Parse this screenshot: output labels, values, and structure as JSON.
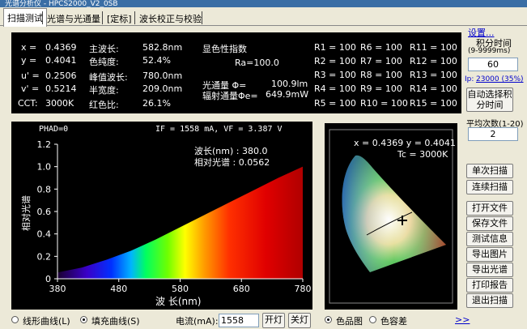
{
  "window": {
    "title": "光谱分析仪 - HPCS2000_V2_0SB"
  },
  "tabs": [
    "扫描测试",
    "光谱与光通量",
    "[定标]",
    "波长校正与校验"
  ],
  "summary": {
    "x": "x =",
    "x_val": "0.4369",
    "y": "y =",
    "y_val": "0.4041",
    "u": "u' =",
    "u_val": "0.2506",
    "v": "v' =",
    "v_val": "0.5214",
    "cct": "CCT:",
    "cct_val": "3000K",
    "dominant": "主波长:",
    "dominant_val": "582.8nm",
    "purity": "色纯度:",
    "purity_val": "52.4%",
    "peak": "峰值波长:",
    "peak_val": "780.0nm",
    "halfwidth": "半宽度:",
    "halfwidth_val": "209.0nm",
    "redratio": "红色比:",
    "redratio_val": "26.1%",
    "cri_title": "显色性指数",
    "ra": "Ra=100.0",
    "flux_label": "光通量 Φ=",
    "flux_val": "100.9lm",
    "radiant_label": "辐射通量Φe=",
    "radiant_val": "649.9mW",
    "r_values": [
      [
        "R1 = 100",
        "R6 = 100",
        "R11 = 100"
      ],
      [
        "R2 = 100",
        "R7 = 100",
        "R12 = 100"
      ],
      [
        "R3 = 100",
        "R8 = 100",
        "R13 = 100"
      ],
      [
        "R4 = 100",
        "R9 = 100",
        "R14 = 100"
      ],
      [
        "R5 = 100",
        "R10 = 100",
        "R15 = 100"
      ]
    ]
  },
  "chart_data": {
    "type": "area",
    "header_left": "PHAD=0",
    "header_right": "IF = 1558 mA, VF = 3.387 V",
    "xlabel": "波 长(nm)",
    "ylabel": "相对光谱",
    "xlim": [
      380,
      780
    ],
    "ylim": [
      0,
      1.2
    ],
    "xticks": [
      "380",
      "480",
      "580",
      "680",
      "780"
    ],
    "yticks": [
      "0",
      "0.2",
      "0.4",
      "0.6",
      "0.8",
      "1.0",
      "1.2"
    ],
    "cursor_wl_label": "波长(nm) : 380.0",
    "cursor_rel_label": "相对光谱 : 0.0562",
    "x": [
      380,
      420,
      460,
      500,
      540,
      580,
      620,
      660,
      700,
      740,
      780
    ],
    "values": [
      0.056,
      0.1,
      0.17,
      0.25,
      0.35,
      0.46,
      0.57,
      0.68,
      0.79,
      0.9,
      1.0
    ]
  },
  "cie": {
    "readout": "x = 0.4369 y = 0.4041",
    "tc": "Tc = 3000K"
  },
  "side": {
    "settings_link": "设置...",
    "integ_label": "积分时间",
    "integ_range": "(9-9999ms)",
    "integ_val": "60",
    "ip_label": "Ip:",
    "ip_val": "23000 (35%)",
    "auto_btn_1": "自动选择积",
    "auto_btn_2": "分时间",
    "avg_label": "平均次数(1-20)",
    "avg_val": "2",
    "single_scan": "单次扫描",
    "continuous_scan": "连续扫描",
    "open_file": "打开文件",
    "save_file": "保存文件",
    "test_info": "测试信息",
    "export_img": "导出图片",
    "export_spec": "导出光谱",
    "print_report": "打印报告",
    "exit_scan": "退出扫描"
  },
  "bottom": {
    "line_curve": "线形曲线(L)",
    "fill_curve": "填充曲线(S)",
    "current_label": "电流(mA):",
    "current_val": "1558",
    "on_btn": "开灯",
    "off_btn": "关灯",
    "color_map": "色品图",
    "color_tol": "色容差",
    "more": ">>"
  },
  "colors": {
    "accent": "#3a6ea5",
    "link": "#0000cc"
  }
}
